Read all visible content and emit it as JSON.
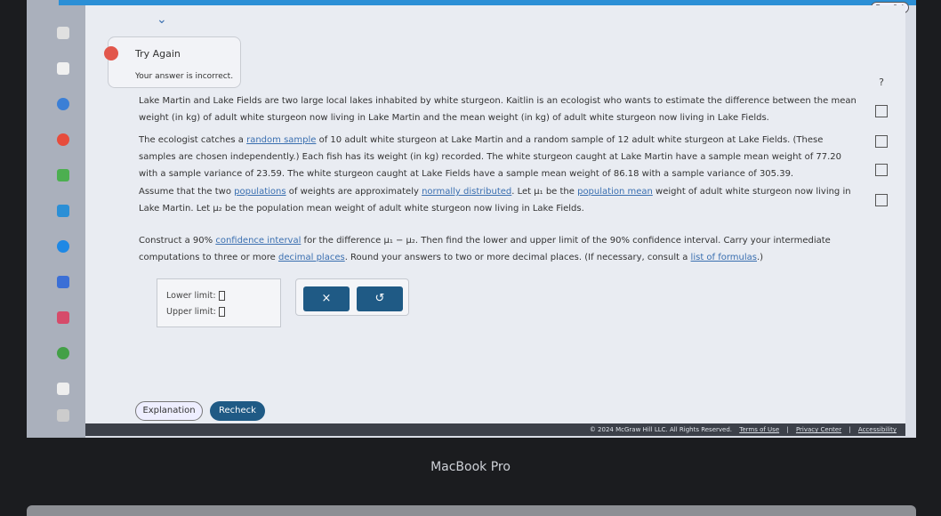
{
  "header": {
    "language_button": "Español"
  },
  "feedback": {
    "title": "Try Again",
    "message": "Your answer is incorrect."
  },
  "question": {
    "p1": "Lake Martin and Lake Fields are two large local lakes inhabited by white sturgeon. Kaitlin is an ecologist who wants to estimate the difference between the mean weight (in kg) of adult white sturgeon now living in Lake Martin and the mean weight (in kg) of adult white sturgeon now living in Lake Fields.",
    "p2a": "The ecologist catches a ",
    "p2_link": "random sample",
    "p2b": " of 10 adult white sturgeon at Lake Martin and a random sample of 12 adult white sturgeon at Lake Fields. (These samples are chosen independently.) Each fish has its weight (in kg) recorded. The white sturgeon caught at Lake Martin have a sample mean weight of 77.20 with a sample variance of 23.59. The white sturgeon caught at Lake Fields have a sample mean weight of 86.18 with a sample variance of 305.39.",
    "p3a": "Assume that the two ",
    "p3_link1": "populations",
    "p3b": " of weights are approximately ",
    "p3_link2": "normally distributed",
    "p3c": ". Let μ₁ be the ",
    "p3_link3": "population mean",
    "p3d": " weight of adult white sturgeon now living in Lake Martin. Let μ₂ be the population mean weight of adult white sturgeon now living in Lake Fields.",
    "p4a": "Construct a 90% ",
    "p4_link1": "confidence interval",
    "p4b": " for the difference μ₁ − μ₂. Then find the lower and upper limit of the 90% confidence interval. Carry your intermediate computations to three or more ",
    "p4_link2": "decimal places",
    "p4c": ". Round your answers to two or more decimal places. (If necessary, consult a ",
    "p4_link3": "list of formulas",
    "p4d": ".)"
  },
  "answer": {
    "lower_label": "Lower limit:",
    "upper_label": "Upper limit:",
    "lower_value": "",
    "upper_value": ""
  },
  "buttons": {
    "clear": "×",
    "undo": "↺",
    "explanation": "Explanation",
    "recheck": "Recheck",
    "help": "?"
  },
  "footer": {
    "copyright": "© 2024 McGraw Hill LLC. All Rights Reserved.",
    "terms": "Terms of Use",
    "privacy": "Privacy Center",
    "accessibility": "Accessibility",
    "sep": "|"
  },
  "device": {
    "brand": "MacBook Pro"
  }
}
